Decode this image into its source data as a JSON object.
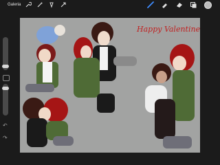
{
  "app": {
    "gallery_label": "Galeria"
  },
  "toolbar": {
    "left_icons": [
      "wrench-icon",
      "magic-wand-icon",
      "selection-icon",
      "transform-arrow-icon"
    ],
    "right_tools": [
      "brush-icon",
      "smudge-icon",
      "eraser-icon",
      "layers-icon"
    ],
    "active_tool": "brush-icon",
    "current_color": "#bdbdbd"
  },
  "canvas": {
    "background": "#a2a3a2",
    "handwritten_text": "Happy Valentine's Day"
  },
  "sidebar": {
    "controls": [
      "brush-size-slider",
      "modify-button",
      "opacity-slider",
      "undo-button",
      "redo-button"
    ]
  }
}
